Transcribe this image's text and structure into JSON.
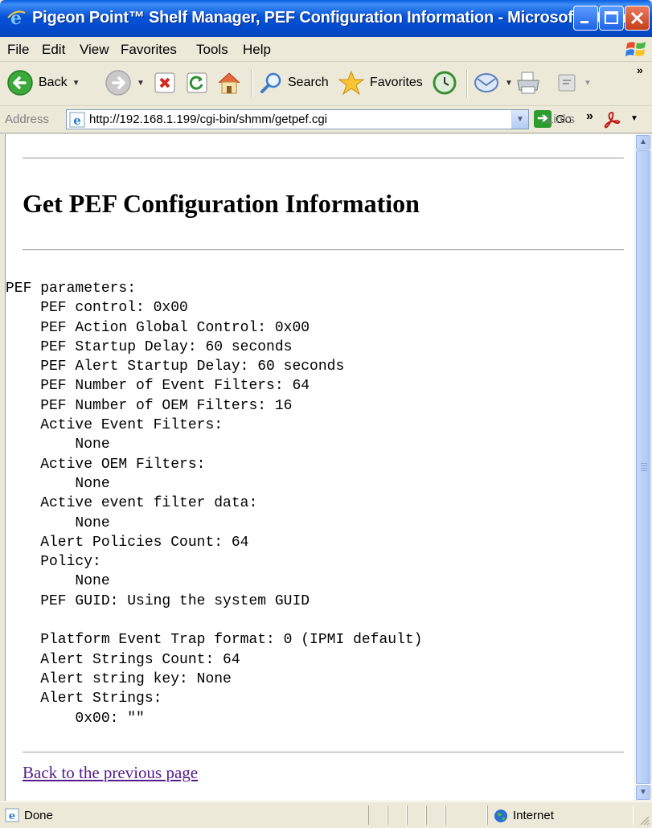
{
  "window": {
    "title": "Pigeon Point™ Shelf Manager, PEF Configuration Information - Microsoft Intern...",
    "controls": [
      "minimize",
      "maximize",
      "close"
    ]
  },
  "menu": {
    "file": "File",
    "edit": "Edit",
    "view": "View",
    "favorites": "Favorites",
    "tools": "Tools",
    "help": "Help"
  },
  "toolbar": {
    "back": "Back",
    "search": "Search",
    "favorites": "Favorites"
  },
  "address": {
    "label": "Address",
    "url": "http://192.168.1.199/cgi-bin/shmm/getpef.cgi",
    "go": "Go",
    "links": "Links"
  },
  "page": {
    "heading": "Get PEF Configuration Information",
    "back_link": "Back to the previous page",
    "params_title": "PEF parameters:",
    "params": [
      {
        "indent": 1,
        "text": "PEF control: 0x00"
      },
      {
        "indent": 1,
        "text": "PEF Action Global Control: 0x00"
      },
      {
        "indent": 1,
        "text": "PEF Startup Delay: 60 seconds"
      },
      {
        "indent": 1,
        "text": "PEF Alert Startup Delay: 60 seconds"
      },
      {
        "indent": 1,
        "text": "PEF Number of Event Filters: 64"
      },
      {
        "indent": 1,
        "text": "PEF Number of OEM Filters: 16"
      },
      {
        "indent": 1,
        "text": "Active Event Filters:"
      },
      {
        "indent": 2,
        "text": "None"
      },
      {
        "indent": 1,
        "text": "Active OEM Filters:"
      },
      {
        "indent": 2,
        "text": "None"
      },
      {
        "indent": 1,
        "text": "Active event filter data:"
      },
      {
        "indent": 2,
        "text": "None"
      },
      {
        "indent": 1,
        "text": "Alert Policies Count: 64"
      },
      {
        "indent": 1,
        "text": "Policy:"
      },
      {
        "indent": 2,
        "text": "None"
      },
      {
        "indent": 1,
        "text": "PEF GUID: Using the system GUID"
      },
      {
        "indent": 0,
        "text": ""
      },
      {
        "indent": 1,
        "text": "Platform Event Trap format: 0 (IPMI default)"
      },
      {
        "indent": 1,
        "text": "Alert Strings Count: 64"
      },
      {
        "indent": 1,
        "text": "Alert string key: None"
      },
      {
        "indent": 1,
        "text": "Alert Strings:"
      },
      {
        "indent": 2,
        "text": "0x00: \"\""
      }
    ]
  },
  "status": {
    "text": "Done",
    "zone": "Internet"
  }
}
